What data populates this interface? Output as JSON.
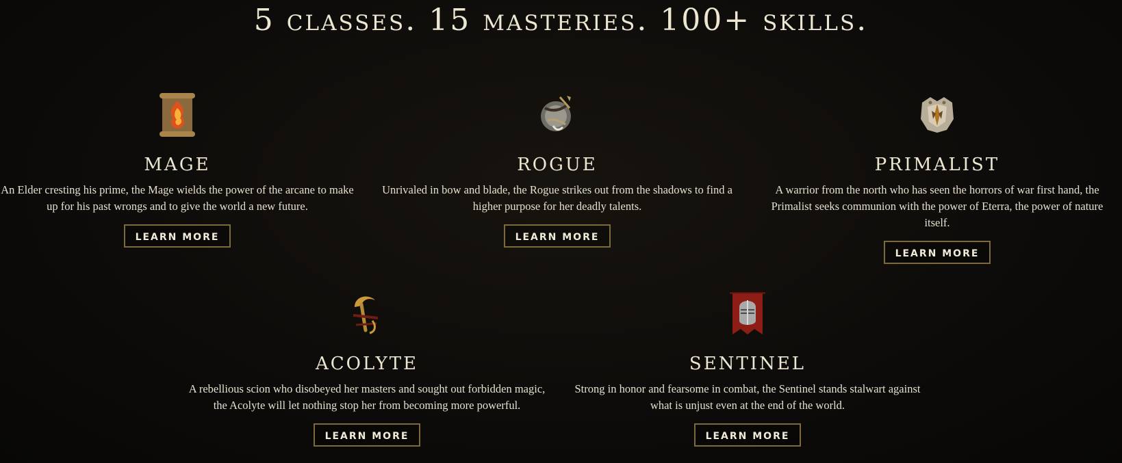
{
  "headline": "5 classes. 15 masteries. 100+ skills.",
  "classes": [
    {
      "name": "MAGE",
      "icon": "mage-scroll-fire-icon",
      "description": "An Elder cresting his prime, the Mage wields the power of the arcane to make up for his past wrongs and to give the world a new future.",
      "button_label": "LEARN MORE"
    },
    {
      "name": "ROGUE",
      "icon": "rogue-bow-emblem-icon",
      "description": "Unrivaled in bow and blade, the Rogue strikes out from the shadows to find a higher purpose for her deadly talents.",
      "button_label": "LEARN MORE"
    },
    {
      "name": "PRIMALIST",
      "icon": "primalist-totem-icon",
      "description": "A warrior from the north who has seen the horrors of war first hand, the Primalist seeks communion with the power of Eterra, the power of nature itself.",
      "button_label": "LEARN MORE"
    },
    {
      "name": "ACOLYTE",
      "icon": "acolyte-sickle-icon",
      "description": "A rebellious scion who disobeyed her masters and sought out forbidden magic, the Acolyte will let nothing stop her from becoming more powerful.",
      "button_label": "LEARN MORE"
    },
    {
      "name": "SENTINEL",
      "icon": "sentinel-helmet-banner-icon",
      "description": "Strong in honor and fearsome in combat, the Sentinel stands stalwart against what is unjust even at the end of the world.",
      "button_label": "LEARN MORE"
    }
  ],
  "colors": {
    "background": "#0d0c0a",
    "text": "#e8e2d0",
    "button_border": "#7d6a3a"
  }
}
